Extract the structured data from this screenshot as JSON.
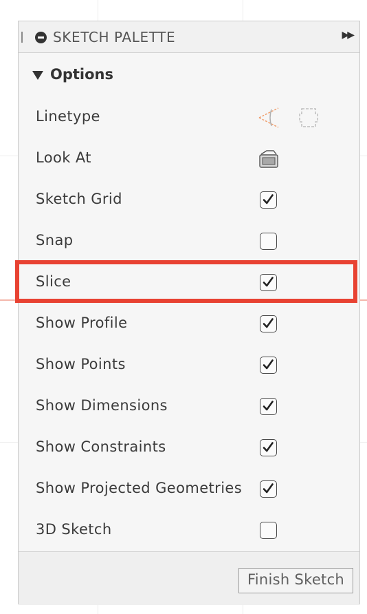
{
  "palette": {
    "title": "SKETCH PALETTE",
    "section_title": "Options",
    "rows": [
      {
        "label": "Linetype",
        "control": "icons",
        "icons": [
          "construction-line-icon",
          "centerline-icon"
        ]
      },
      {
        "label": "Look At",
        "control": "icon",
        "icons": [
          "look-at-icon"
        ]
      },
      {
        "label": "Sketch Grid",
        "control": "checkbox",
        "checked": true
      },
      {
        "label": "Snap",
        "control": "checkbox",
        "checked": false
      },
      {
        "label": "Slice",
        "control": "checkbox",
        "checked": true,
        "highlighted": true
      },
      {
        "label": "Show Profile",
        "control": "checkbox",
        "checked": true
      },
      {
        "label": "Show Points",
        "control": "checkbox",
        "checked": true
      },
      {
        "label": "Show Dimensions",
        "control": "checkbox",
        "checked": true
      },
      {
        "label": "Show Constraints",
        "control": "checkbox",
        "checked": true
      },
      {
        "label": "Show Projected Geometries",
        "control": "checkbox",
        "checked": true
      },
      {
        "label": "3D Sketch",
        "control": "checkbox",
        "checked": false
      }
    ],
    "finish_label": "Finish Sketch"
  },
  "colors": {
    "highlight": "#e84232",
    "axis_line": "#f4b7ab"
  }
}
